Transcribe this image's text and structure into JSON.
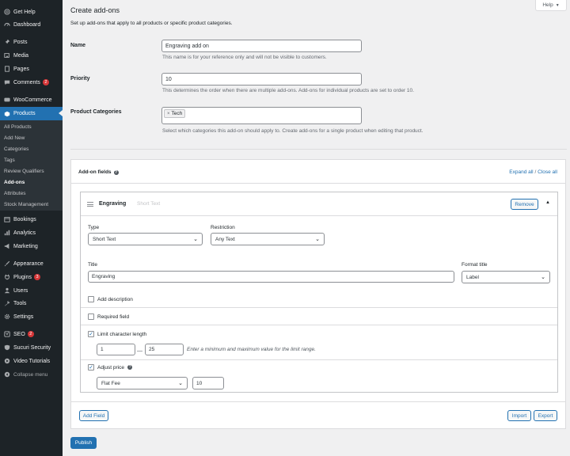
{
  "sidebar": {
    "items": [
      {
        "label": "Get Help",
        "icon": "help-icon"
      },
      {
        "label": "Dashboard",
        "icon": "dashboard-icon"
      },
      {
        "label": "Posts",
        "icon": "pin-icon"
      },
      {
        "label": "Media",
        "icon": "media-icon"
      },
      {
        "label": "Pages",
        "icon": "pages-icon"
      },
      {
        "label": "Comments",
        "icon": "comment-icon",
        "badge": "2"
      },
      {
        "label": "WooCommerce",
        "icon": "woocommerce-icon"
      },
      {
        "label": "Products",
        "icon": "products-icon",
        "active": true
      },
      {
        "label": "Bookings",
        "icon": "calendar-icon"
      },
      {
        "label": "Analytics",
        "icon": "analytics-icon"
      },
      {
        "label": "Marketing",
        "icon": "megaphone-icon"
      },
      {
        "label": "Appearance",
        "icon": "brush-icon"
      },
      {
        "label": "Plugins",
        "icon": "plugin-icon",
        "badge": "3"
      },
      {
        "label": "Users",
        "icon": "users-icon"
      },
      {
        "label": "Tools",
        "icon": "wrench-icon"
      },
      {
        "label": "Settings",
        "icon": "settings-icon"
      },
      {
        "label": "SEO",
        "icon": "yoast-icon",
        "badge": "2"
      },
      {
        "label": "Sucuri Security",
        "icon": "shield-icon"
      },
      {
        "label": "Video Tutorials",
        "icon": "video-icon"
      },
      {
        "label": "Collapse menu",
        "icon": "collapse-icon"
      }
    ],
    "submenu": [
      "All Products",
      "Add New",
      "Categories",
      "Tags",
      "Review Qualifiers",
      "Add-ons",
      "Attributes",
      "Stock Management"
    ],
    "submenu_current": "Add-ons"
  },
  "header": {
    "title": "Create add-ons",
    "help_label": "Help",
    "intro": "Set up add-ons that apply to all products or specific product categories."
  },
  "form": {
    "name_label": "Name",
    "name_value": "Engraving add on",
    "name_desc": "This name is for your reference only and will not be visible to customers.",
    "priority_label": "Priority",
    "priority_value": "10",
    "priority_desc": "This determines the order when there are multiple add-ons. Add-ons for individual products are set to order 10.",
    "categories_label": "Product Categories",
    "category_tag": "Tech",
    "tag_remove": "×",
    "categories_desc": "Select which categories this add-on should apply to. Create add-ons for a single product when editing that product."
  },
  "addon_fields": {
    "title": "Add-on fields",
    "info_glyph": "?",
    "expand_all": "Expand all",
    "separator": "/",
    "close_all": "Close all",
    "field": {
      "name": "Engraving",
      "type_hint": "Short Text",
      "remove_label": "Remove",
      "collapse_glyph": "▲",
      "type_label": "Type",
      "type_value": "Short Text",
      "restriction_label": "Restriction",
      "restriction_value": "Any Text",
      "title_label": "Title",
      "title_value": "Engraving",
      "format_title_label": "Format title",
      "format_title_value": "Label",
      "add_description_label": "Add description",
      "required_label": "Required field",
      "limit_label": "Limit character length",
      "limit_min": "1",
      "range_dash": "—",
      "limit_max": "25",
      "limit_hint": "Enter a minimum and maximum value for the limit range.",
      "adjust_price_label": "Adjust price",
      "price_type_value": "Flat Fee",
      "price_value": "10"
    },
    "add_field_label": "Add Field",
    "import_label": "Import",
    "export_label": "Export"
  },
  "publish_label": "Publish",
  "colors": {
    "sidebar_bg": "#1d2327",
    "accent": "#2271b1",
    "badge": "#d63638"
  }
}
